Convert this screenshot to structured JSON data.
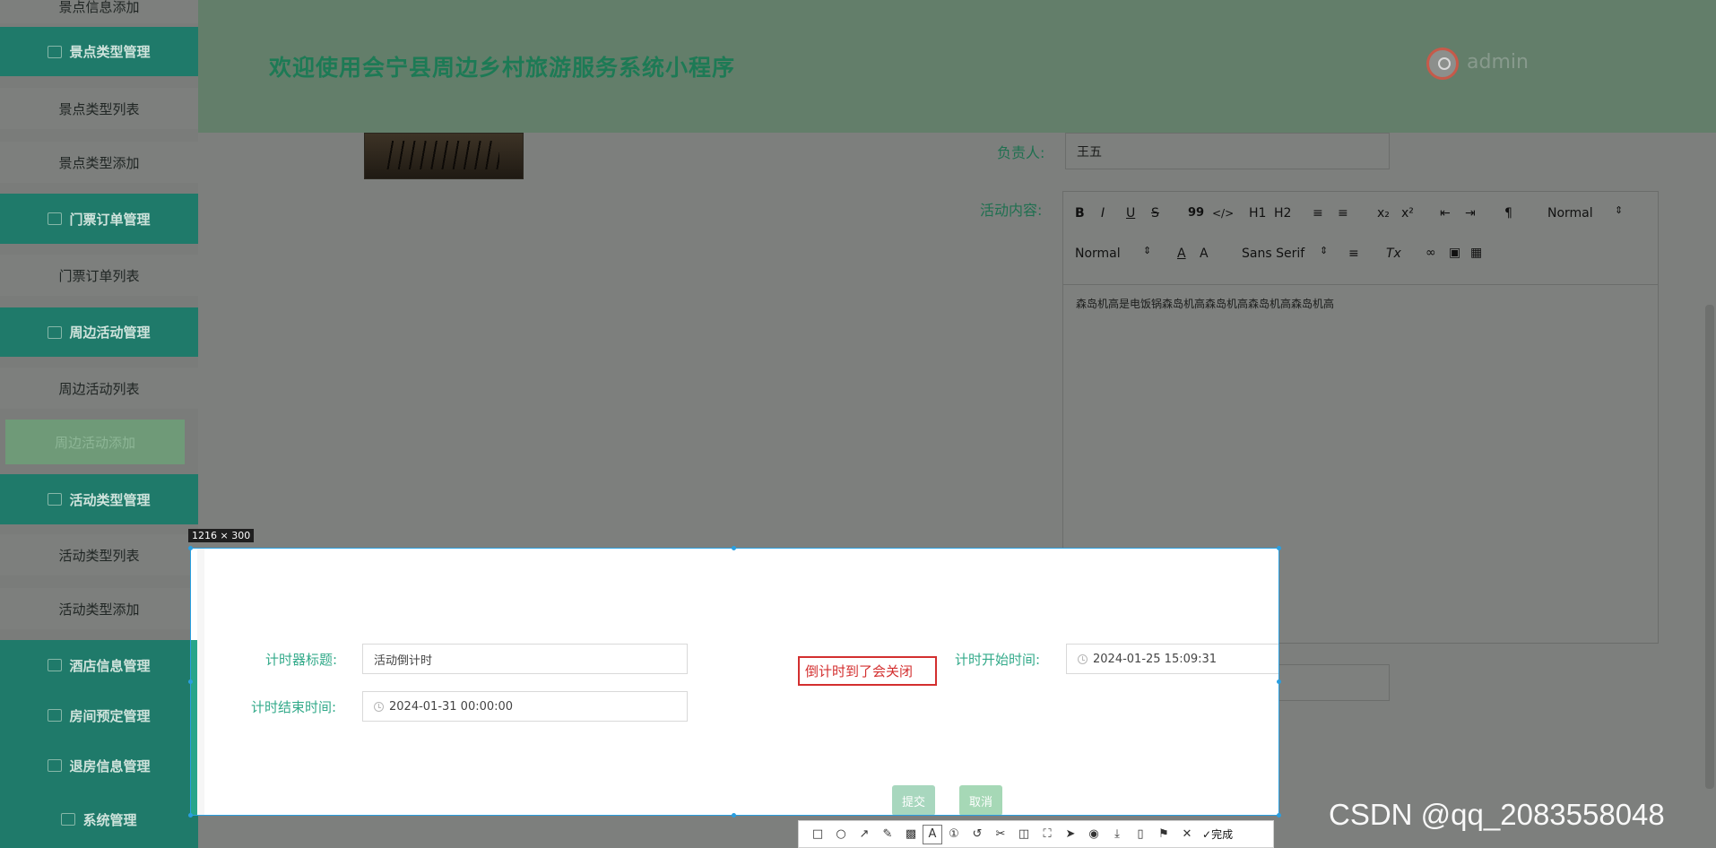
{
  "sidebar": {
    "items": [
      {
        "label": "景点信息添加",
        "type": "sub"
      },
      {
        "label": "景点类型管理",
        "type": "head"
      },
      {
        "label": "景点类型列表",
        "type": "sub"
      },
      {
        "label": "景点类型添加",
        "type": "sub"
      },
      {
        "label": "门票订单管理",
        "type": "head"
      },
      {
        "label": "门票订单列表",
        "type": "sub"
      },
      {
        "label": "周边活动管理",
        "type": "head"
      },
      {
        "label": "周边活动列表",
        "type": "sub"
      },
      {
        "label": "周边活动添加",
        "type": "sub-active"
      },
      {
        "label": "活动类型管理",
        "type": "head"
      },
      {
        "label": "活动类型列表",
        "type": "sub"
      },
      {
        "label": "活动类型添加",
        "type": "sub"
      },
      {
        "label": "酒店信息管理",
        "type": "head"
      },
      {
        "label": "房间预定管理",
        "type": "head"
      },
      {
        "label": "退房信息管理",
        "type": "head"
      },
      {
        "label": "系统管理",
        "type": "head"
      }
    ]
  },
  "header": {
    "title": "欢迎使用会宁县周边乡村旅游服务系统小程序",
    "user": "admin"
  },
  "form": {
    "owner_label": "负责人:",
    "owner_value": "王五",
    "content_label": "活动内容:",
    "editor": {
      "bold": "B",
      "italic": "I",
      "underline": "U",
      "strike": "S",
      "quote": "99",
      "code": "</>",
      "h1": "H1",
      "h2": "H2",
      "sub": "x₂",
      "sup": "x²",
      "rtl": "¶",
      "header_select": "Normal",
      "size_select": "Normal",
      "font_select": "Sans Serif",
      "clean": "Tx",
      "text": "森岛机高是电饭锅森岛机高森岛机高森岛机高森岛机高"
    }
  },
  "snip": {
    "size_badge": "1216 × 300",
    "timer_title_label": "计时器标题:",
    "timer_title_value": "活动倒计时",
    "annotation": "倒计时到了会关闭",
    "start_label": "计时开始时间:",
    "start_value": "2024-01-25 15:09:31",
    "end_label": "计时结束时间:",
    "end_value": "2024-01-31 00:00:00",
    "submit": "提交",
    "cancel": "取消",
    "toolbar": {
      "done": "完成",
      "icons": [
        "rectangle-icon",
        "ellipse-icon",
        "arrow-icon",
        "pen-icon",
        "mosaic-icon",
        "text-icon",
        "number-icon",
        "undo-icon",
        "redo-icon",
        "translate-icon",
        "ocr-icon",
        "pin-icon",
        "record-icon",
        "download-icon",
        "long-screenshot-icon",
        "save-icon"
      ]
    }
  },
  "watermark": "CSDN @qq_2083558048",
  "colors": {
    "sidebar_head": "#1f7a6a",
    "accent_green": "#33aa8a",
    "annotation_red": "#d32f2f",
    "selection_blue": "#2a9fe0"
  }
}
